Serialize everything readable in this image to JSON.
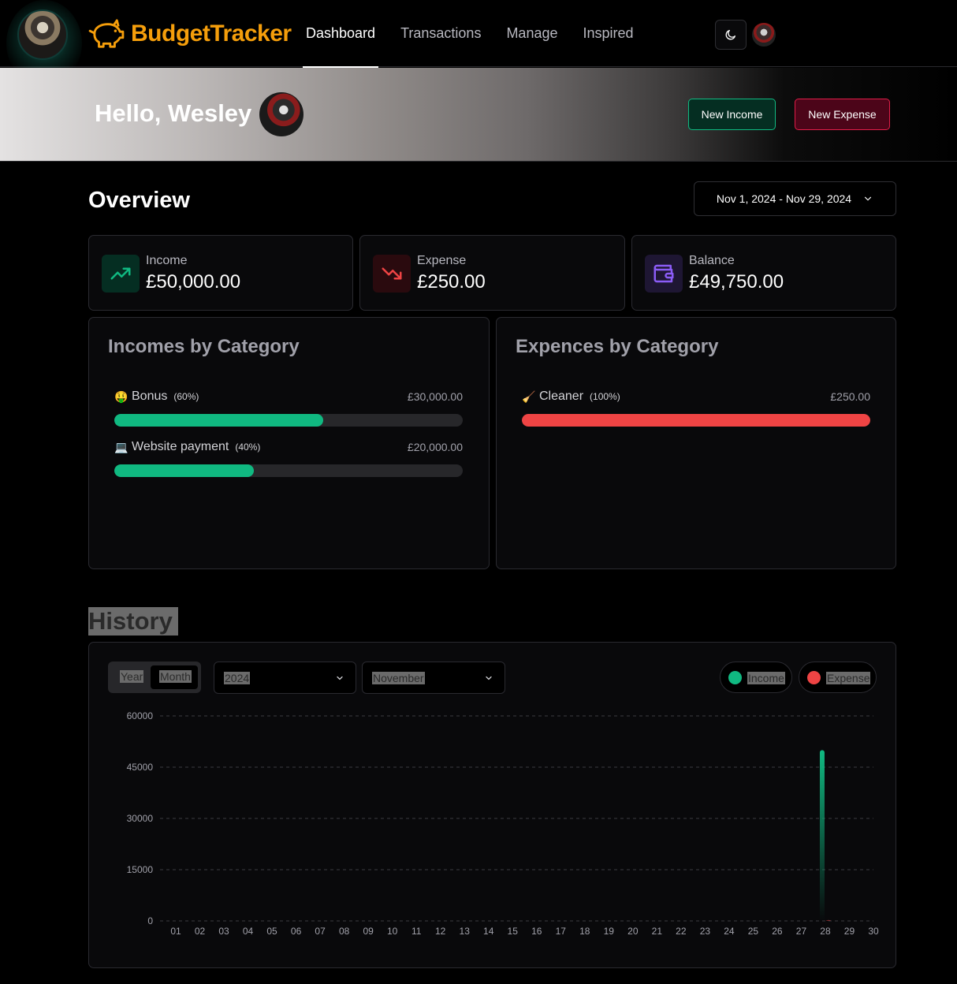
{
  "nav": {
    "logo_text": "BudgetTracker",
    "links": [
      "Dashboard",
      "Transactions",
      "Manage",
      "Inspired"
    ],
    "active": "Dashboard"
  },
  "hero": {
    "greeting": "Hello, Wesley",
    "new_income": "New Income",
    "new_expense": "New Expense"
  },
  "overview": {
    "title": "Overview",
    "date_range": "Nov 1, 2024 - Nov 29, 2024",
    "stats": [
      {
        "label": "Income",
        "value": "£50,000.00",
        "color": "#10b981"
      },
      {
        "label": "Expense",
        "value": "£250.00",
        "color": "#ef4444"
      },
      {
        "label": "Balance",
        "value": "£49,750.00",
        "color": "#8b5cf6"
      }
    ]
  },
  "incomes_by_category": {
    "title": "Incomes by Category",
    "items": [
      {
        "emoji": "🤑",
        "name": "Bonus",
        "percent_label": "(60%)",
        "amount": "£30,000.00",
        "fraction": 0.6
      },
      {
        "emoji": "💻",
        "name": "Website payment",
        "percent_label": "(40%)",
        "amount": "£20,000.00",
        "fraction": 0.4
      }
    ]
  },
  "expenses_by_category": {
    "title": "Expences by Category",
    "items": [
      {
        "emoji": "🧹",
        "name": "Cleaner",
        "percent_label": "(100%)",
        "amount": "£250.00",
        "fraction": 1.0
      }
    ]
  },
  "history": {
    "title": "History",
    "tabs": [
      "Year",
      "Month"
    ],
    "active_tab": "Month",
    "year": "2024",
    "month": "November",
    "legend": [
      {
        "label": "Income",
        "color": "#10b981"
      },
      {
        "label": "Expense",
        "color": "#ef4444"
      }
    ]
  },
  "chart_data": {
    "type": "bar",
    "categories": [
      "01",
      "02",
      "03",
      "04",
      "05",
      "06",
      "07",
      "08",
      "09",
      "10",
      "11",
      "12",
      "13",
      "14",
      "15",
      "16",
      "17",
      "18",
      "19",
      "20",
      "21",
      "22",
      "23",
      "24",
      "25",
      "26",
      "27",
      "28",
      "29",
      "30"
    ],
    "series": [
      {
        "name": "Income",
        "values": [
          0,
          0,
          0,
          0,
          0,
          0,
          0,
          0,
          0,
          0,
          0,
          0,
          0,
          0,
          0,
          0,
          0,
          0,
          0,
          0,
          0,
          0,
          0,
          0,
          0,
          0,
          0,
          50000,
          0,
          0
        ]
      },
      {
        "name": "Expense",
        "values": [
          0,
          0,
          0,
          0,
          0,
          0,
          0,
          0,
          0,
          0,
          0,
          0,
          0,
          0,
          0,
          0,
          0,
          0,
          0,
          0,
          0,
          0,
          0,
          0,
          0,
          0,
          0,
          250,
          0,
          0
        ]
      }
    ],
    "yticks": [
      "0",
      "15000",
      "30000",
      "45000",
      "60000"
    ],
    "ylim": [
      0,
      60000
    ],
    "grid": true,
    "legend": "top-right"
  }
}
